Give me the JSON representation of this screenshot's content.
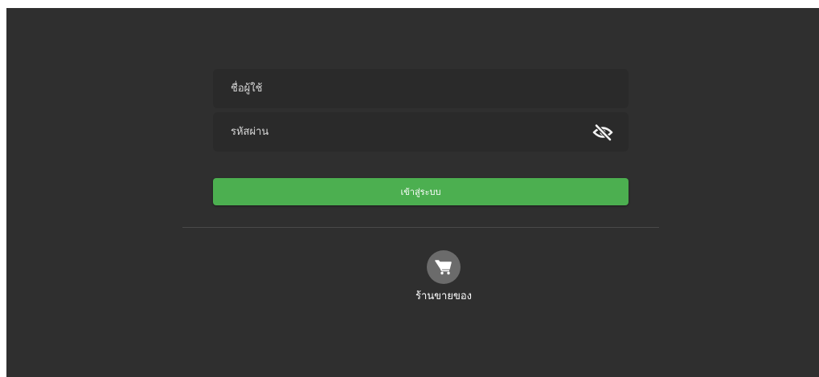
{
  "login_form": {
    "username_placeholder": "ชื่อผู้ใช้",
    "password_placeholder": "รหัสผ่าน",
    "toggle_password_icon": "eye-slash-icon",
    "submit_label": "เข้าสู่ระบบ"
  },
  "links": {
    "shop_label": "ร้านขายของ",
    "shop_icon": "shopping-cart-icon"
  },
  "colors": {
    "background": "#2f2f2f",
    "field_background": "#2a2a2a",
    "accent": "#4caf50",
    "icon_circle": "#6b6b6b"
  }
}
